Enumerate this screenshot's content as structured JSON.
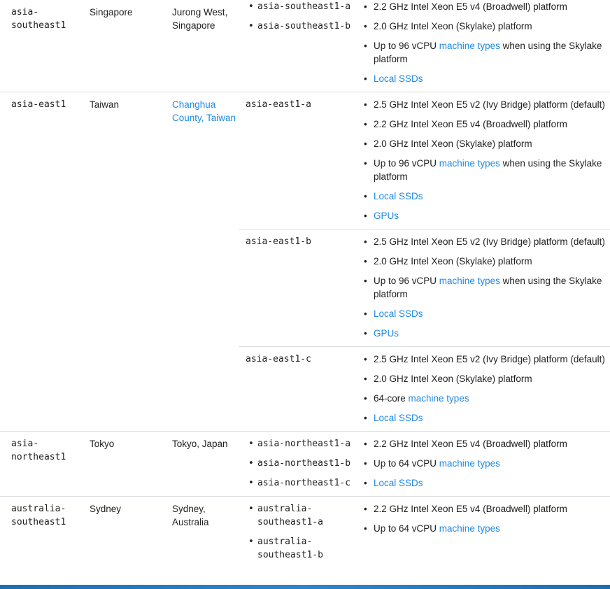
{
  "colors": {
    "link": "#1e88e5",
    "divider": "#dadce0",
    "text": "#212121",
    "bottom_bar": "#2f85c9"
  },
  "rows": [
    {
      "region": "asia-\nsoutheast1",
      "location": "Singapore",
      "city": "Jurong West, Singapore",
      "zones": [
        {
          "names": [
            "asia-southeast1-a",
            "asia-southeast1-b"
          ],
          "features": [
            {
              "text": "2.2 GHz Intel Xeon E5 v4 (Broadwell) platform"
            },
            {
              "text": "2.0 GHz Intel Xeon (Skylake) platform"
            },
            {
              "before": "Up to 96 vCPU ",
              "link": "machine types",
              "after": " when using the Skylake platform"
            },
            {
              "link": "Local SSDs"
            }
          ]
        }
      ]
    },
    {
      "region": "asia-east1",
      "location": "Taiwan",
      "city_link": "Changhua County, Taiwan",
      "zones": [
        {
          "plain": "asia-east1-a",
          "features": [
            {
              "text": "2.5 GHz Intel Xeon E5 v2 (Ivy Bridge) platform (default)"
            },
            {
              "text": "2.2 GHz Intel Xeon E5 v4 (Broadwell) platform"
            },
            {
              "text": "2.0 GHz Intel Xeon (Skylake) platform"
            },
            {
              "before": "Up to 96 vCPU ",
              "link": "machine types",
              "after": " when using the Skylake platform"
            },
            {
              "link": "Local SSDs"
            },
            {
              "link": "GPUs"
            }
          ]
        },
        {
          "plain": "asia-east1-b",
          "features": [
            {
              "text": "2.5 GHz Intel Xeon E5 v2 (Ivy Bridge) platform (default)"
            },
            {
              "text": "2.0 GHz Intel Xeon (Skylake) platform"
            },
            {
              "before": "Up to 96 vCPU ",
              "link": "machine types",
              "after": " when using the Skylake platform"
            },
            {
              "link": "Local SSDs"
            },
            {
              "link": "GPUs"
            }
          ]
        },
        {
          "plain": "asia-east1-c",
          "features": [
            {
              "text": "2.5 GHz Intel Xeon E5 v2 (Ivy Bridge) platform (default)"
            },
            {
              "text": "2.0 GHz Intel Xeon (Skylake) platform"
            },
            {
              "before": "64-core ",
              "link": "machine types"
            },
            {
              "link": "Local SSDs"
            }
          ]
        }
      ]
    },
    {
      "region": "asia-\nnortheast1",
      "location": "Tokyo",
      "city": "Tokyo, Japan",
      "zones": [
        {
          "names": [
            "asia-northeast1-a",
            "asia-northeast1-b",
            "asia-northeast1-c"
          ],
          "features": [
            {
              "text": "2.2 GHz Intel Xeon E5 v4 (Broadwell) platform"
            },
            {
              "before": "Up to 64 vCPU ",
              "link": "machine types"
            },
            {
              "link": "Local SSDs"
            }
          ]
        }
      ]
    },
    {
      "region": "australia-\nsoutheast1",
      "location": "Sydney",
      "city": "Sydney, Australia",
      "zones": [
        {
          "names": [
            "australia-\nsoutheast1-a",
            "australia-\nsoutheast1-b"
          ],
          "features": [
            {
              "text": "2.2 GHz Intel Xeon E5 v4 (Broadwell) platform"
            },
            {
              "before": "Up to 64 vCPU ",
              "link": "machine types"
            }
          ]
        }
      ]
    }
  ]
}
